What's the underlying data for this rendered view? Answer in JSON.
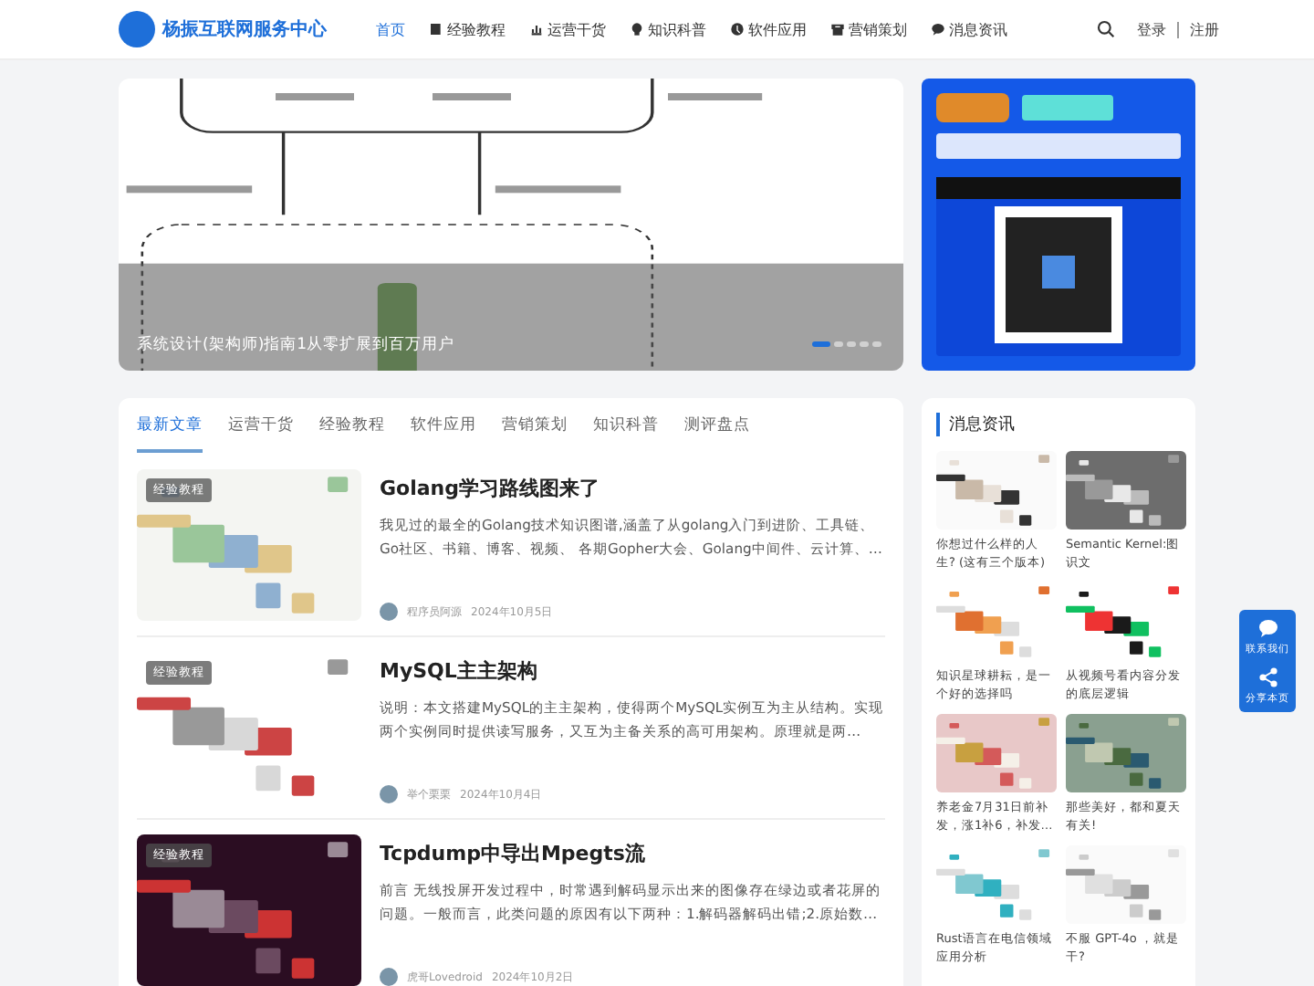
{
  "header": {
    "site_title": "杨振互联网服务中心",
    "nav": [
      {
        "label": "首页",
        "selected": true
      },
      {
        "label": "经验教程",
        "selected": false
      },
      {
        "label": "运营干货",
        "selected": false
      },
      {
        "label": "知识科普",
        "selected": false
      },
      {
        "label": "软件应用",
        "selected": false
      },
      {
        "label": "营销策划",
        "selected": false
      },
      {
        "label": "消息资讯",
        "selected": false
      }
    ],
    "login": "登录",
    "register": "注册"
  },
  "banner": {
    "caption": "系统设计(架构师)指南1从零扩展到百万用户",
    "dots": [
      {
        "selected": true
      },
      {
        "selected": false
      },
      {
        "selected": false
      },
      {
        "selected": false
      },
      {
        "selected": false
      }
    ]
  },
  "articles": {
    "tabs": [
      {
        "label": "最新文章",
        "selected": true
      },
      {
        "label": "运营干货",
        "selected": false
      },
      {
        "label": "经验教程",
        "selected": false
      },
      {
        "label": "软件应用",
        "selected": false
      },
      {
        "label": "营销策划",
        "selected": false
      },
      {
        "label": "知识科普",
        "selected": false
      },
      {
        "label": "测评盘点",
        "selected": false
      }
    ],
    "items": [
      {
        "tag": "经验教程",
        "title": "Golang学习路线图来了",
        "excerpt": "我见过的最全的Golang技术知识图谱,涵盖了从golang入门到进阶、工具链、Go社区、书籍、博客、视频、 各期Gopher大会、Golang中间件、云计算、…",
        "author": "程序员阿源",
        "date": "2024年10月5日"
      },
      {
        "tag": "经验教程",
        "title": "MySQL主主架构",
        "excerpt": "  说明：本文搭建MySQL的主主架构，使得两个MySQL实例互为主从结构。实现两个实例同时提供读写服务，又互为主备关系的高可用架构。原理就是两…",
        "author": "举个栗栗",
        "date": "2024年10月4日"
      },
      {
        "tag": "经验教程",
        "title": "Tcpdump中导出Mpegts流",
        "excerpt": "前言 无线投屏开发过程中，时常遇到解码显示出来的图像存在绿边或者花屏的问题。一般而言，此类问题的原因有以下两种：1.解码器解码出错;2.原始数…",
        "author": "虎哥Lovedroid",
        "date": "2024年10月2日"
      }
    ]
  },
  "news": {
    "title": "消息资讯",
    "items": [
      {
        "caption": "你想过什么样的人生? (这有三个版本)"
      },
      {
        "caption": "Semantic Kernel:图识文"
      },
      {
        "caption": "知识星球耕耘，是一个好的选择吗"
      },
      {
        "caption": "从视频号看内容分发的底层逻辑"
      },
      {
        "caption": "养老金7月31日前补发，涨1补6，补发…"
      },
      {
        "caption": "那些美好，都和夏天有关!"
      },
      {
        "caption": "Rust语言在电信领域应用分析"
      },
      {
        "caption": "不服 GPT-4o ，就是干?"
      }
    ]
  },
  "float_tools": [
    {
      "label": "联系我们"
    },
    {
      "label": "分享本页"
    }
  ]
}
